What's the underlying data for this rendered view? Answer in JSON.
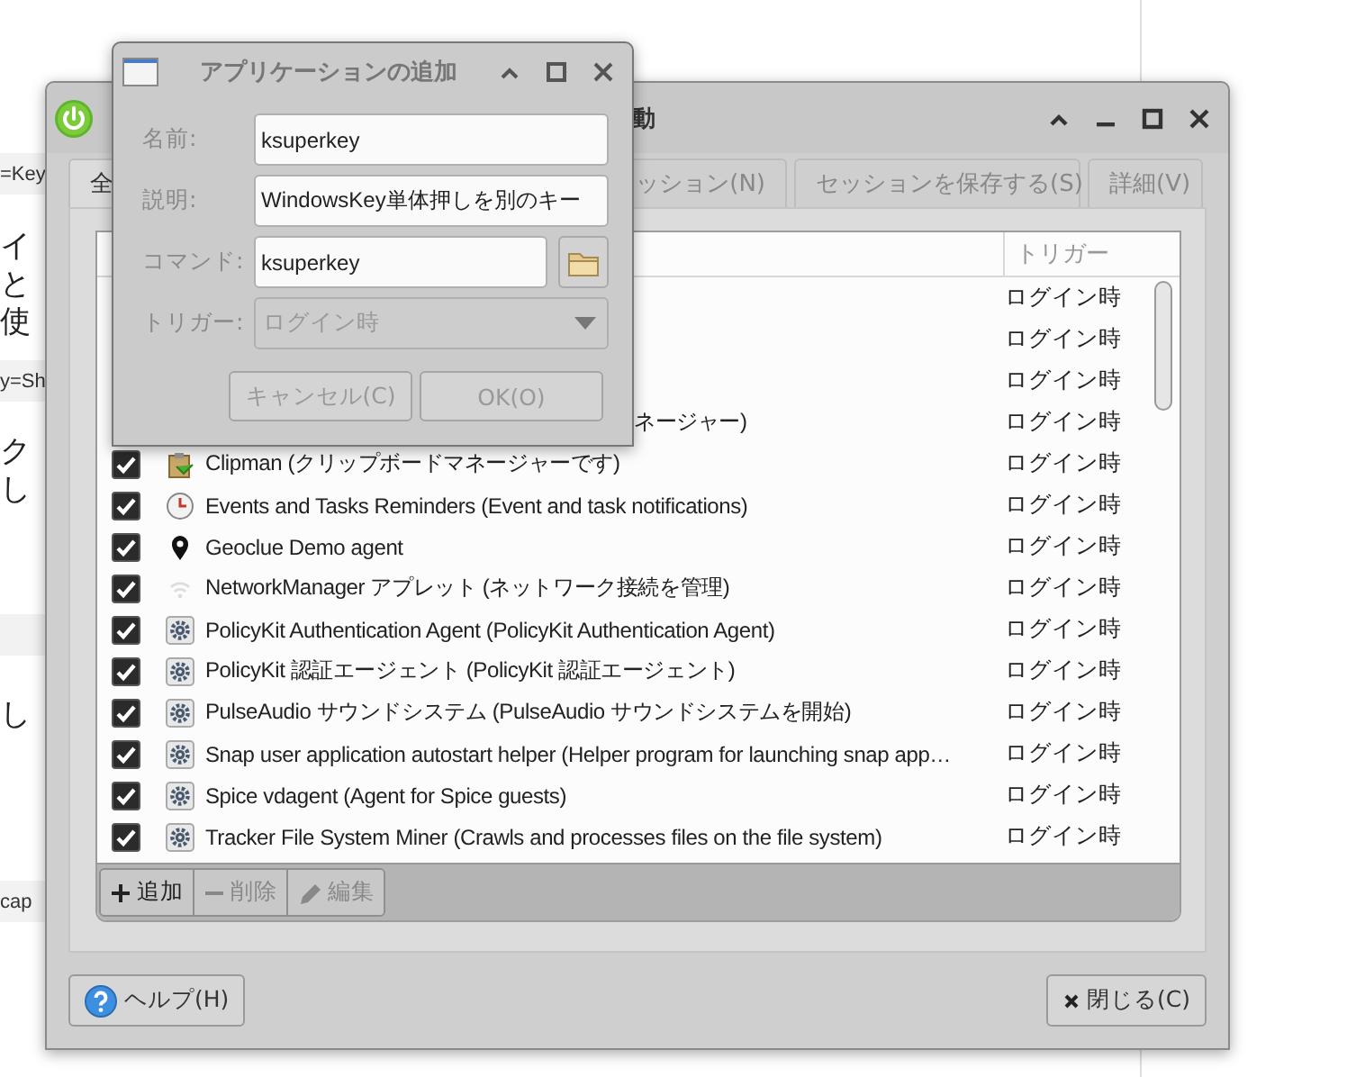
{
  "background_page": {
    "blocks": [
      {
        "kind": "code",
        "lines": [
          "=Key"
        ]
      },
      {
        "kind": "text",
        "lines": [
          "イ",
          "と",
          "使"
        ]
      },
      {
        "kind": "code",
        "lines": [
          "y=Sh"
        ]
      },
      {
        "kind": "text",
        "lines": [
          "ク",
          "し"
        ]
      },
      {
        "kind": "code"
      },
      {
        "kind": "text",
        "lines": [
          "し"
        ]
      },
      {
        "kind": "code",
        "lines": [
          "cap"
        ]
      }
    ]
  },
  "main_window": {
    "title": "動",
    "tabs": [
      {
        "label": "全",
        "selected": true
      },
      {
        "label": "ッション(N)",
        "selected": false
      },
      {
        "label": "セッションを保存する(S)",
        "selected": false
      },
      {
        "label": "詳細(V)",
        "selected": false
      }
    ],
    "table": {
      "columns": [
        "トリガー"
      ],
      "rows": [
        {
          "kind": "covered",
          "trigger": "ログイン時"
        },
        {
          "kind": "covered",
          "trigger": "ログイン時"
        },
        {
          "kind": "covered",
          "trigger": "ログイン時"
        },
        {
          "kind": "covered",
          "name": "ネージャー)",
          "trigger": "ログイン時"
        },
        {
          "kind": "clipboard",
          "checked": true,
          "name": "Clipman (クリップボードマネージャーです)",
          "trigger": "ログイン時"
        },
        {
          "kind": "clock",
          "checked": true,
          "name": "Events and Tasks Reminders (Event and task notifications)",
          "trigger": "ログイン時"
        },
        {
          "kind": "location",
          "checked": true,
          "name": "Geoclue Demo agent",
          "trigger": "ログイン時"
        },
        {
          "kind": "network",
          "checked": true,
          "name": "NetworkManager アプレット (ネットワーク接続を管理)",
          "trigger": "ログイン時"
        },
        {
          "kind": "service",
          "checked": true,
          "name": "PolicyKit Authentication Agent (PolicyKit Authentication Agent)",
          "trigger": "ログイン時"
        },
        {
          "kind": "service",
          "checked": true,
          "name": "PolicyKit 認証エージェント (PolicyKit 認証エージェント)",
          "trigger": "ログイン時"
        },
        {
          "kind": "service",
          "checked": true,
          "name": "PulseAudio サウンドシステム (PulseAudio サウンドシステムを開始)",
          "trigger": "ログイン時"
        },
        {
          "kind": "service",
          "checked": true,
          "name": "Snap user application autostart helper (Helper program for launching snap app…",
          "trigger": "ログイン時"
        },
        {
          "kind": "service",
          "checked": true,
          "name": "Spice vdagent (Agent for Spice guests)",
          "trigger": "ログイン時"
        },
        {
          "kind": "service",
          "checked": true,
          "name": "Tracker File System Miner (Crawls and processes files on the file system)",
          "trigger": "ログイン時"
        }
      ]
    },
    "toolbar": [
      {
        "kind": "add",
        "label": "追加",
        "disabled": false
      },
      {
        "kind": "remove",
        "label": "削除",
        "disabled": true
      },
      {
        "kind": "edit",
        "label": "編集",
        "disabled": true
      }
    ],
    "help_button": "ヘルプ(H)",
    "close_button": "閉じる(C)"
  },
  "dialog": {
    "title": "アプリケーションの追加",
    "fields": [
      {
        "kind": "text",
        "label": "名前:",
        "value": "ksuperkey"
      },
      {
        "kind": "text",
        "label": "説明:",
        "value": "WindowsKey単体押しを別のキー"
      },
      {
        "kind": "file",
        "label": "コマンド:",
        "value": "ksuperkey"
      },
      {
        "kind": "select",
        "label": "トリガー:",
        "value": "ログイン時",
        "disabled": true
      }
    ],
    "buttons": [
      {
        "label": "キャンセル(C)",
        "disabled": true
      },
      {
        "label": "OK(O)",
        "disabled": true
      }
    ]
  }
}
